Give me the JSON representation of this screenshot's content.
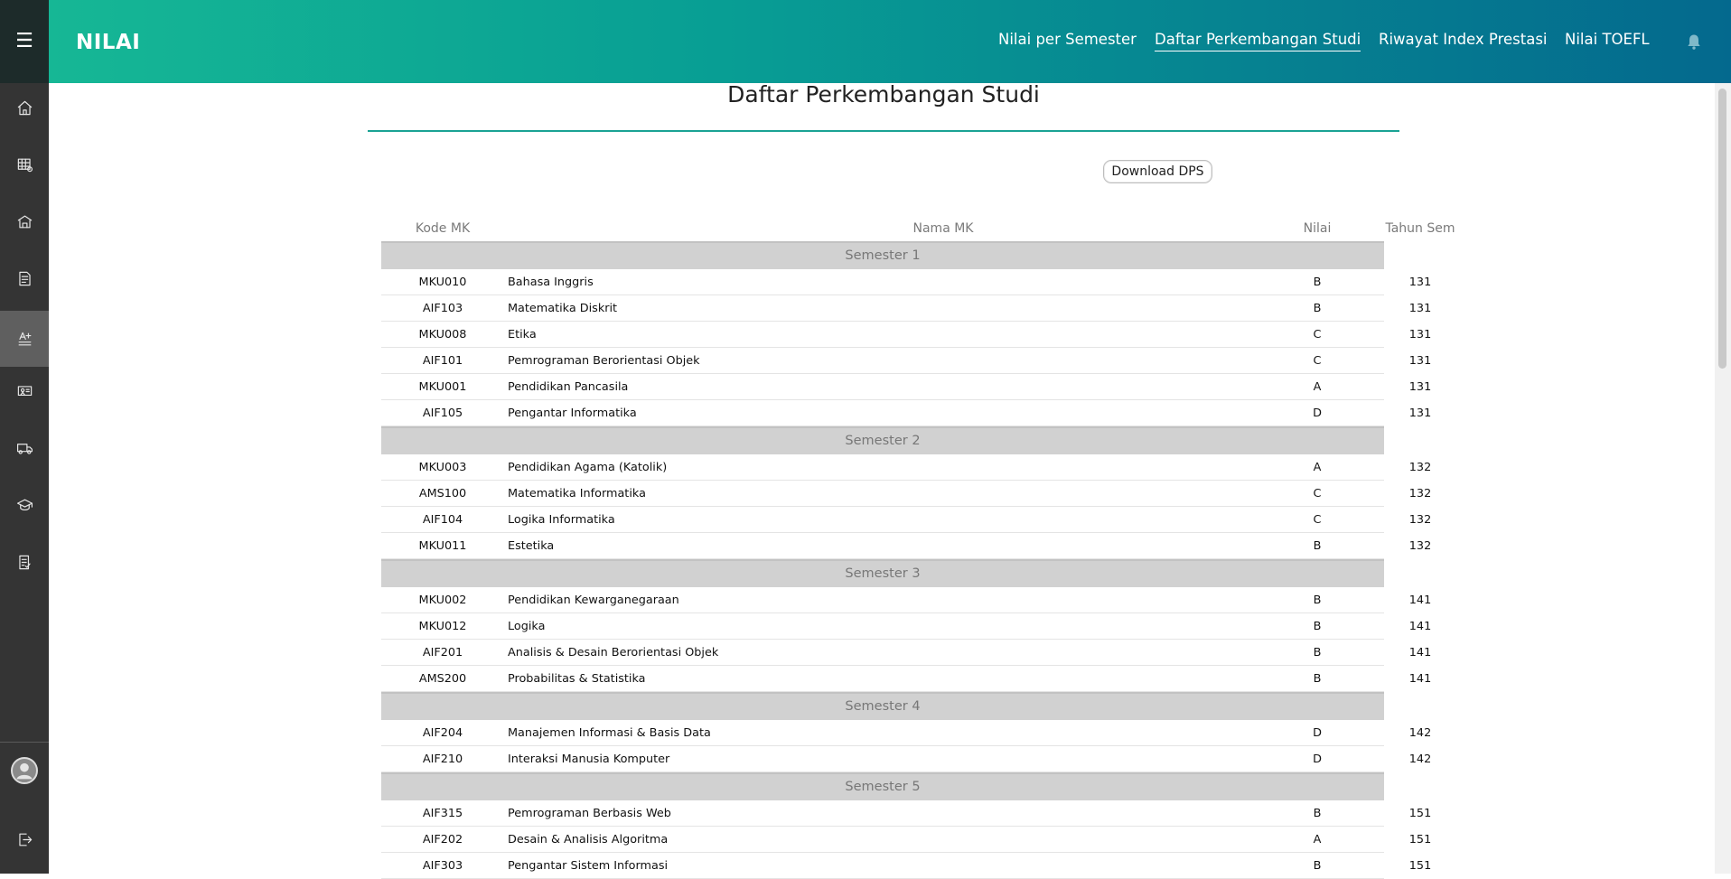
{
  "app": {
    "title": "NILAI"
  },
  "nav": [
    {
      "label": "Nilai per Semester",
      "active": false
    },
    {
      "label": "Daftar Perkembangan Studi",
      "active": true
    },
    {
      "label": "Riwayat Index Prestasi",
      "active": false
    },
    {
      "label": "Nilai TOEFL",
      "active": false
    }
  ],
  "sidebar": {
    "menu_icon": "hamburger-icon",
    "items": [
      {
        "icon": "home-icon",
        "active": false
      },
      {
        "icon": "schedule-grid-icon",
        "active": false
      },
      {
        "icon": "building-icon",
        "active": false
      },
      {
        "icon": "document-icon",
        "active": false
      },
      {
        "icon": "grade-icon",
        "active": true
      },
      {
        "icon": "presentation-icon",
        "active": false
      },
      {
        "icon": "truck-icon",
        "active": false
      },
      {
        "icon": "graduation-cap-icon",
        "active": false
      },
      {
        "icon": "checklist-icon",
        "active": false
      }
    ],
    "bottom": [
      {
        "icon": "user-avatar-icon"
      },
      {
        "icon": "logout-icon"
      }
    ]
  },
  "page": {
    "title": "Daftar Perkembangan Studi",
    "download_label": "Download DPS"
  },
  "table": {
    "headers": {
      "kode": "Kode MK",
      "nama": "Nama MK",
      "nilai": "Nilai",
      "tahun": "Tahun Sem"
    },
    "semesters": [
      {
        "label": "Semester 1",
        "rows": [
          {
            "kode": "MKU010",
            "nama": "Bahasa Inggris",
            "nilai": "B",
            "tahun": "131"
          },
          {
            "kode": "AIF103",
            "nama": "Matematika Diskrit",
            "nilai": "B",
            "tahun": "131"
          },
          {
            "kode": "MKU008",
            "nama": "Etika",
            "nilai": "C",
            "tahun": "131"
          },
          {
            "kode": "AIF101",
            "nama": "Pemrograman Berorientasi Objek",
            "nilai": "C",
            "tahun": "131"
          },
          {
            "kode": "MKU001",
            "nama": "Pendidikan Pancasila",
            "nilai": "A",
            "tahun": "131"
          },
          {
            "kode": "AIF105",
            "nama": "Pengantar Informatika",
            "nilai": "D",
            "tahun": "131"
          }
        ]
      },
      {
        "label": "Semester 2",
        "rows": [
          {
            "kode": "MKU003",
            "nama": "Pendidikan Agama (Katolik)",
            "nilai": "A",
            "tahun": "132"
          },
          {
            "kode": "AMS100",
            "nama": "Matematika Informatika",
            "nilai": "C",
            "tahun": "132"
          },
          {
            "kode": "AIF104",
            "nama": "Logika Informatika",
            "nilai": "C",
            "tahun": "132"
          },
          {
            "kode": "MKU011",
            "nama": "Estetika",
            "nilai": "B",
            "tahun": "132"
          }
        ]
      },
      {
        "label": "Semester 3",
        "rows": [
          {
            "kode": "MKU002",
            "nama": "Pendidikan Kewarganegaraan",
            "nilai": "B",
            "tahun": "141"
          },
          {
            "kode": "MKU012",
            "nama": "Logika",
            "nilai": "B",
            "tahun": "141"
          },
          {
            "kode": "AIF201",
            "nama": "Analisis & Desain Berorientasi Objek",
            "nilai": "B",
            "tahun": "141"
          },
          {
            "kode": "AMS200",
            "nama": "Probabilitas & Statistika",
            "nilai": "B",
            "tahun": "141"
          }
        ]
      },
      {
        "label": "Semester 4",
        "rows": [
          {
            "kode": "AIF204",
            "nama": "Manajemen Informasi & Basis Data",
            "nilai": "D",
            "tahun": "142"
          },
          {
            "kode": "AIF210",
            "nama": "Interaksi Manusia Komputer",
            "nilai": "D",
            "tahun": "142"
          }
        ]
      },
      {
        "label": "Semester 5",
        "rows": [
          {
            "kode": "AIF315",
            "nama": "Pemrograman Berbasis Web",
            "nilai": "B",
            "tahun": "151"
          },
          {
            "kode": "AIF202",
            "nama": "Desain & Analisis Algoritma",
            "nilai": "A",
            "tahun": "151"
          },
          {
            "kode": "AIF303",
            "nama": "Pengantar Sistem Informasi",
            "nilai": "B",
            "tahun": "151"
          }
        ]
      }
    ]
  },
  "colors": {
    "header_start": "#16b795",
    "header_end": "#04698e",
    "sidebar": "#343434",
    "accent_rule": "#1aa394",
    "semester_band": "#d1d1d1"
  }
}
